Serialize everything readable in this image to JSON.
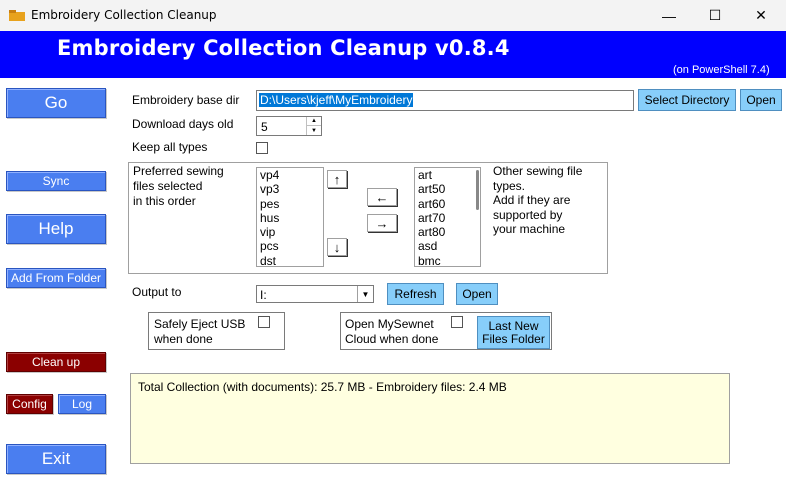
{
  "window": {
    "title": "Embroidery Collection Cleanup",
    "minimize_glyph": "—",
    "maximize_glyph": "☐",
    "close_glyph": "✕"
  },
  "banner": {
    "title": "Embroidery Collection Cleanup v0.8.4",
    "subtitle": "(on PowerShell 7.4)",
    "color": "#0000ff"
  },
  "nav": {
    "go": "Go",
    "sync": "Sync",
    "help": "Help",
    "add_from_folder": "Add From Folder",
    "clean_up": "Clean up",
    "config": "Config",
    "log": "Log",
    "exit": "Exit"
  },
  "form": {
    "base_dir_label": "Embroidery base dir",
    "base_dir_value": "D:\\Users\\kjeff\\MyEmbroidery",
    "select_directory": "Select Directory",
    "open_dir": "Open",
    "days_label": "Download days old",
    "days_value": "5",
    "keep_all_label": "Keep all types",
    "keep_all_checked": false
  },
  "types": {
    "preferred_label_1": "Preferred sewing",
    "preferred_label_2": "files selected",
    "preferred_label_3": "in this order",
    "preferred": [
      "vp4",
      "vp3",
      "pes",
      "hus",
      "vip",
      "pcs",
      "dst"
    ],
    "other": [
      "art",
      "art50",
      "art60",
      "art70",
      "art80",
      "asd",
      "bmc"
    ],
    "other_label_1": "Other sewing file",
    "other_label_2": "types.",
    "other_label_3": "Add if they are",
    "other_label_4": "supported by",
    "other_label_5": "your machine",
    "up_glyph": "↑",
    "down_glyph": "↓",
    "left_glyph": "←",
    "right_glyph": "→"
  },
  "output": {
    "label": "Output to",
    "value": "I:",
    "refresh": "Refresh",
    "open": "Open",
    "eject_line1": "Safely Eject USB",
    "eject_line2": "when done",
    "mysewnet_line1": "Open MySewnet",
    "mysewnet_line2": "Cloud when done",
    "last_new_line1": "Last New",
    "last_new_line2": "Files Folder"
  },
  "status": {
    "text": "Total Collection (with documents): 25.7 MB - Embroidery files: 2.4 MB"
  }
}
